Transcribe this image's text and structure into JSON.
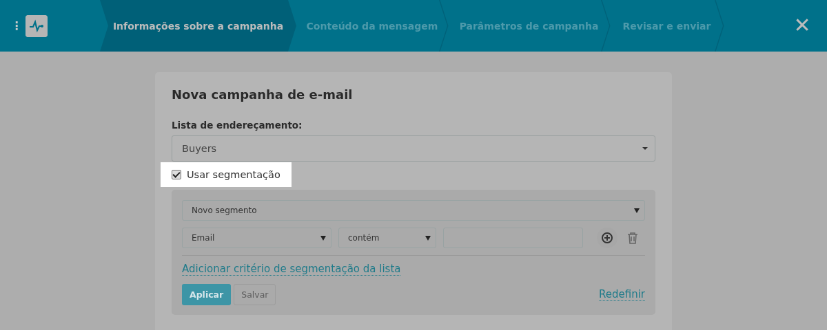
{
  "header": {
    "menu_icon": "⋮",
    "steps": [
      {
        "label": "Informações sobre a campanha",
        "selected": true
      },
      {
        "label": "Conteúdo da mensagem",
        "selected": false
      },
      {
        "label": "Parâmetros de campanha",
        "selected": false
      },
      {
        "label": "Revisar e enviar",
        "selected": false
      }
    ],
    "close": "✕"
  },
  "card": {
    "title": "Nova campanha de e-mail",
    "list_label": "Lista de endereçamento:",
    "list_value": "Buyers",
    "segmentation": {
      "label": "Usar segmentação",
      "checked": true
    },
    "segment_panel": {
      "segment_select": "Novo segmento",
      "field_select": "Email",
      "operator_select": "contém",
      "add_link": "Adicionar critério de segmentação da lista",
      "apply": "Aplicar",
      "save": "Salvar",
      "save_disabled": true,
      "reset": "Redefinir"
    }
  }
}
